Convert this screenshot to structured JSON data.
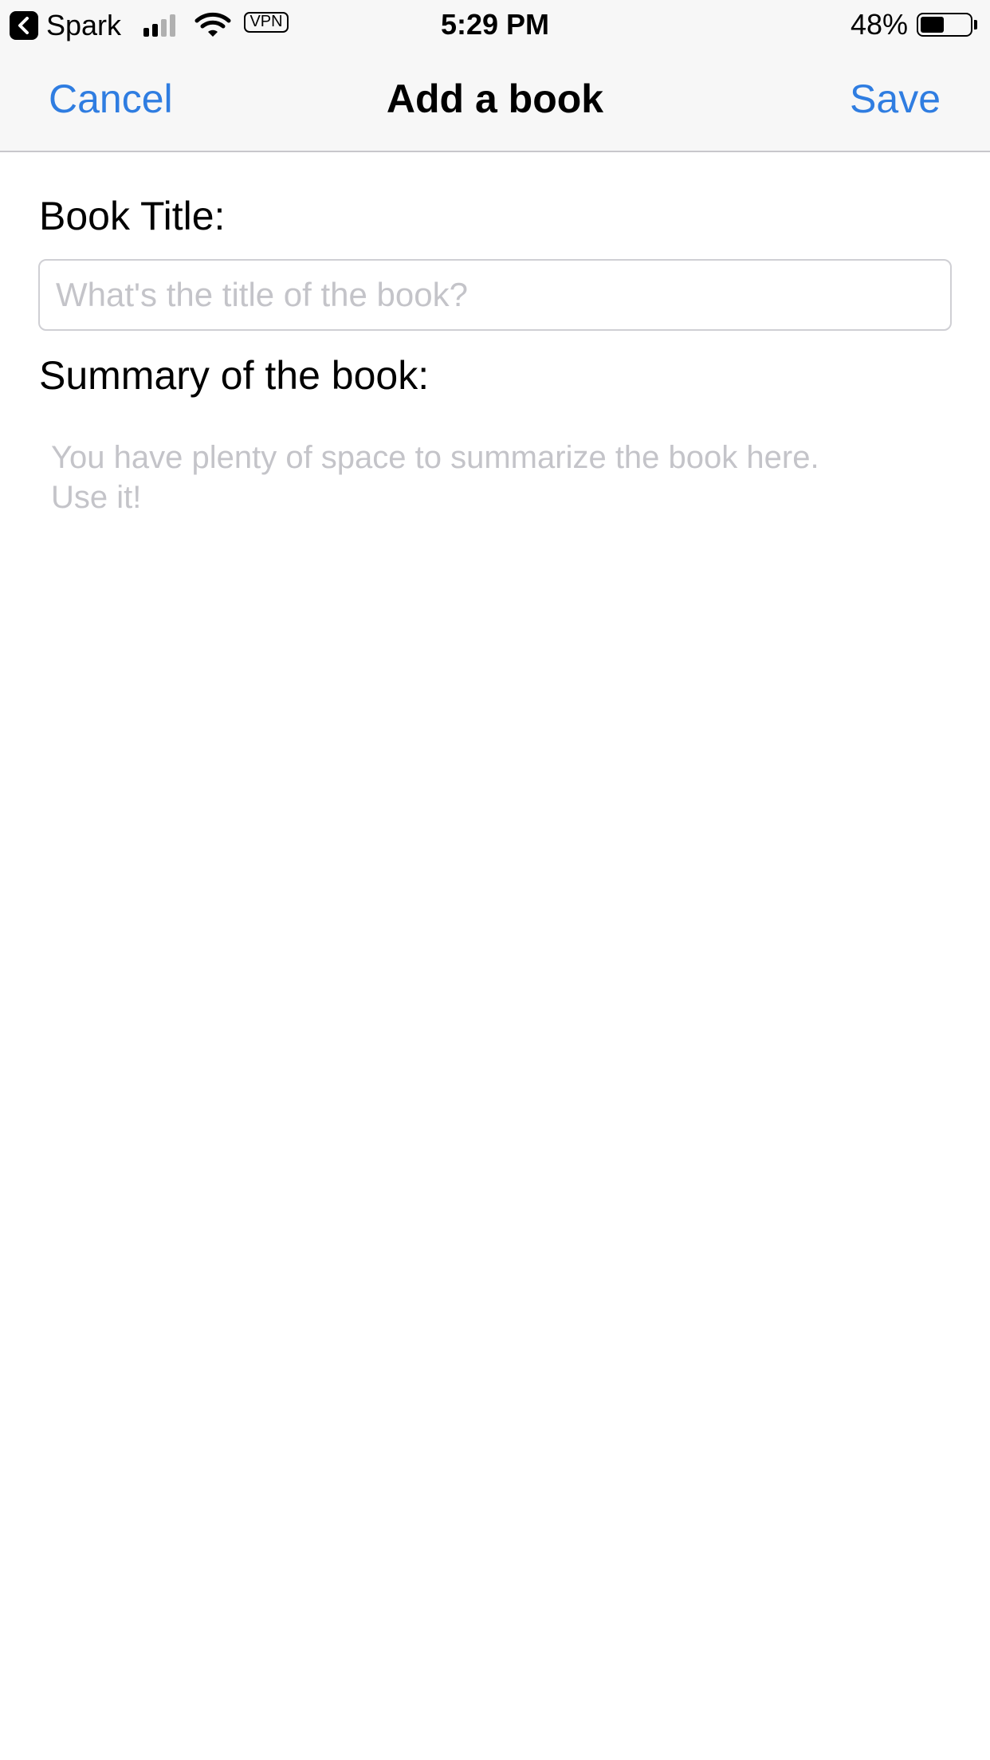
{
  "status_bar": {
    "back_app_label": "Spark",
    "vpn_label": "VPN",
    "time": "5:29 PM",
    "battery_percent": "48%",
    "battery_level": 0.48,
    "signal_bars_active": 2,
    "signal_bars_total": 4
  },
  "nav": {
    "cancel_label": "Cancel",
    "title": "Add a book",
    "save_label": "Save"
  },
  "form": {
    "title_label": "Book Title:",
    "title_placeholder": "What's the title of the book?",
    "title_value": "",
    "summary_label": "Summary of the book:",
    "summary_placeholder": "You have plenty of space to summarize the book here.\nUse it!",
    "summary_value": ""
  },
  "colors": {
    "accent": "#2f7de1",
    "placeholder": "#c4c4c9",
    "bar_background": "#f7f7f7"
  },
  "icons": {
    "back": "chevron-left-icon",
    "signal": "cellular-signal-icon",
    "wifi": "wifi-icon",
    "battery": "battery-icon"
  }
}
